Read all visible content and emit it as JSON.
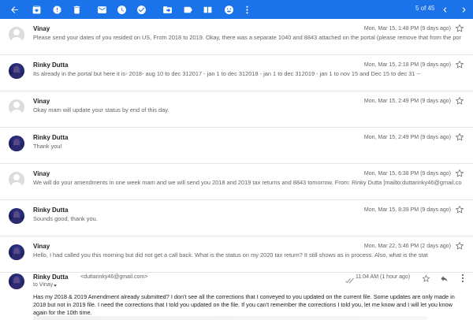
{
  "toolbar": {
    "counter": "5 of 45",
    "icons": [
      "back-arrow-icon",
      "archive-icon",
      "report-spam-icon",
      "delete-icon",
      "mark-unread-icon",
      "snooze-icon",
      "add-task-icon",
      "move-to-icon",
      "labels-icon",
      "emoji-icon",
      "more-vert-icon",
      "chevron-left-icon",
      "chevron-right-icon"
    ],
    "background_color": "#1a73e8"
  },
  "threads": [
    {
      "sender": "Vinay",
      "avatar": "default",
      "date": "Mon, Mar 15, 1:48 PM (9 days ago)",
      "snippet": "Please send your dates of you resided on US, From 2018 to 2019. Okay, there was a separate 1040 and 8843 attached on the portal (please remove that from the por"
    },
    {
      "sender": "Rinky Dutta",
      "avatar": "photo",
      "date": "Mon, Mar 15, 2:18 PM (9 days ago)",
      "snippet": "Its already in the portal but here it is- 2018- aug 10 to dec 312017 - jan 1 to dec 312018 - jan 1 to dec 312019 - jan 1 to nov 15 and Dec 15 to dec 31 --"
    },
    {
      "sender": "Vinay",
      "avatar": "default",
      "date": "Mon, Mar 15, 2:49 PM (9 days ago)",
      "snippet": "Okay mam will update your status by end of this day."
    },
    {
      "sender": "Rinky Dutta",
      "avatar": "photo",
      "date": "Mon, Mar 15, 2:49 PM (9 days ago)",
      "snippet": "Thank you!"
    },
    {
      "sender": "Vinay",
      "avatar": "default",
      "date": "Mon, Mar 15, 6:38 PM (9 days ago)",
      "snippet": "We will do your amendments in one week mam and we will send you 2018 and 2019 tax returns and 8843 tomorrow. From: Rinky Dutta [mailto:duttarinky46@gmail.co"
    },
    {
      "sender": "Rinky Dutta",
      "avatar": "photo",
      "date": "Mon, Mar 15, 8:39 PM (9 days ago)",
      "snippet": "Sounds good, thank you."
    },
    {
      "sender": "Vinay",
      "avatar": "default",
      "date": "Mon, Mar 22, 5:46 PM (2 days ago)",
      "snippet": "Hello, I had called you this morning but did not get a call back. What is the status on my 2020 tax return? It still shows as in process. Also, what is the stat"
    }
  ],
  "expanded": {
    "sender": "Rinky Dutta",
    "email": "<duttarinky46@gmail.com>",
    "to": "to Vinay",
    "date": "11:04 AM (1 hour ago)",
    "body": "Has my 2018 & 2019 Amendment already submitted? I don't see all the corrections that I conveyed to you updated on the current file. Some updates are only made in 2018 but not in 2019 file. I need the corrections that I told you updated on the file. If you can't remember the corrections I told you, let me know and I will let you know again for the 10th time."
  }
}
